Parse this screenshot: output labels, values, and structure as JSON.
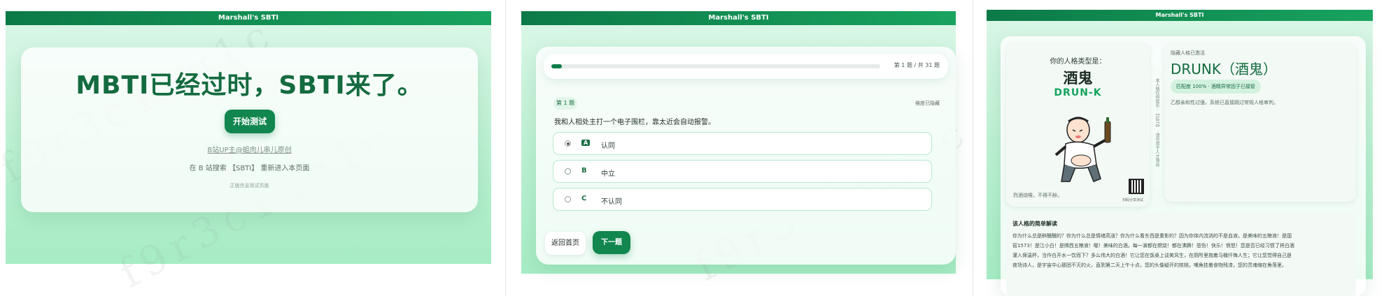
{
  "app_title": "Marshall's SBTI",
  "watermark": "f9r3c1ag1c",
  "screen1": {
    "headline": "MBTI已经过时，SBTI来了。",
    "start_button": "开始测试",
    "link_text": "B站UP主@蛆肉儿串儿原创",
    "hint_text": "在 B 站搜索 【SBTI】 重新进入本页面",
    "footnote": "正版信息测试页面"
  },
  "screen2": {
    "progress_text": "第 1 题 / 共 31 题",
    "progress_fraction": 0.03,
    "question_tag": "第 1 题",
    "dimension_hidden": "维度已隐藏",
    "question_text": "我和人相处主打一个电子围栏，靠太近会自动报警。",
    "options": [
      {
        "code": "A",
        "text": "认同",
        "selected": true
      },
      {
        "code": "B",
        "text": "中立",
        "selected": false
      },
      {
        "code": "C",
        "text": "不认同",
        "selected": false
      }
    ],
    "back_button": "返回首页",
    "next_button": "下一题"
  },
  "screen3": {
    "type_label": "你的人格类型是：",
    "type_name_cn": "酒鬼",
    "type_code": "DRUN-K",
    "caption": "烈酒烧喉，不得不醉。",
    "qr_caption": "扫码分享测试",
    "side_text": "本人格仅供娱乐 · 【SBTI】 · 请勿用于人才筛选",
    "hidden_activated": "隐藏人格已激活",
    "result_title": "DRUNK（酒鬼）",
    "match_badge": "匹配度 100% · 酒精异常因子已接管",
    "result_desc": "乙醇亲和性过强，系统已直接跳过常规人格审判。",
    "interpretation_title": "该人格的简单解读",
    "interpretation_lines": [
      "你为什么总是醉醺醺的？你为什么总是情绪高涨？你为什么看东西是重影的？因为你体内流淌的不是血液，是美味的五粮液！是国",
      "窖1573！是江小白！是牌西五粮液！喔！美味的白酒。每一滴都在燃烧！都在沸腾！悲伤！快乐！愤怒！您是否已经习惯了将白酒",
      "灌入保温杯，当作白开水一饮而下？多么伟大的白酒！它让您在饭桌上谈笑风生，在厕所里抱着马桶忏悔人生；它让您觉得自己是",
      "夜场诗人，是宇宙中心那团不灭的火，直到第二天上午十点，您的头像疑开的核桃，嘴角挂着食物残渣，您的灵魂缩在角落里。"
    ]
  },
  "colors": {
    "accent": "#12864f",
    "header": "#0c7a47",
    "title_green": "#146b3f",
    "bg_mint": "#baf0d1"
  }
}
